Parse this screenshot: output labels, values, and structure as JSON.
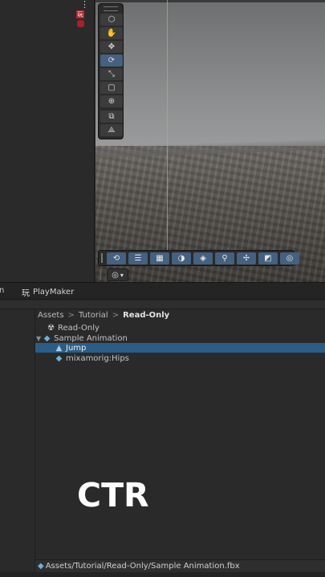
{
  "hierarchy": {
    "menu_icon": "kebab-menu-icon",
    "playmaker_badge": "玩"
  },
  "scene": {
    "tools": [
      {
        "name": "view-tool-icon",
        "glyph": "⬡"
      },
      {
        "name": "hand-tool-icon",
        "glyph": "✋"
      },
      {
        "name": "move-tool-icon",
        "glyph": "✥"
      },
      {
        "name": "rotate-tool-icon",
        "glyph": "⟳"
      },
      {
        "name": "scale-tool-icon",
        "glyph": "⤡"
      },
      {
        "name": "rect-tool-icon",
        "glyph": "▢"
      },
      {
        "name": "transform-tool-icon",
        "glyph": "⊕"
      },
      {
        "name": "custom-tool-icon",
        "glyph": "⧉"
      },
      {
        "name": "collider-tool-icon",
        "glyph": "⟁"
      }
    ],
    "bottom_tools": [
      {
        "name": "loop-icon",
        "glyph": "⟲"
      },
      {
        "name": "sliders-icon",
        "glyph": "☰"
      },
      {
        "name": "grid-icon",
        "glyph": "▦"
      },
      {
        "name": "sphere-icon",
        "glyph": "◑"
      },
      {
        "name": "layers-icon",
        "glyph": "◈"
      },
      {
        "name": "search-icon",
        "glyph": "⚲"
      },
      {
        "name": "pivot-icon",
        "glyph": "✢"
      },
      {
        "name": "camera-icon",
        "glyph": "◩"
      },
      {
        "name": "compass-icon",
        "glyph": "◎"
      }
    ],
    "dropdown_glyph": "◎",
    "dropdown_arrow": "▾"
  },
  "tabs": {
    "partial_label": "n",
    "playmaker_icon": "玩",
    "playmaker_label": "PlayMaker"
  },
  "project": {
    "breadcrumb": [
      "Assets",
      "Tutorial",
      "Read-Only"
    ],
    "breadcrumb_sep": ">",
    "items": [
      {
        "label": "Read-Only",
        "icon": "☢",
        "indent": 1
      },
      {
        "label": "Sample Animation",
        "icon": "◆",
        "indent": 0,
        "expanded": true
      },
      {
        "label": "Jump",
        "icon": "▲",
        "indent": 2,
        "selected": true
      },
      {
        "label": "mixamorig:Hips",
        "icon": "◆",
        "indent": 2
      }
    ],
    "status_path": "Assets/Tutorial/Read-Only/Sample Animation.fbx"
  },
  "overlay_text": "CTR",
  "colors": {
    "selection": "#2c5d87",
    "active_tool": "#46607f",
    "axis_green": "#6fd35a",
    "playmaker_red": "#b22a35"
  }
}
